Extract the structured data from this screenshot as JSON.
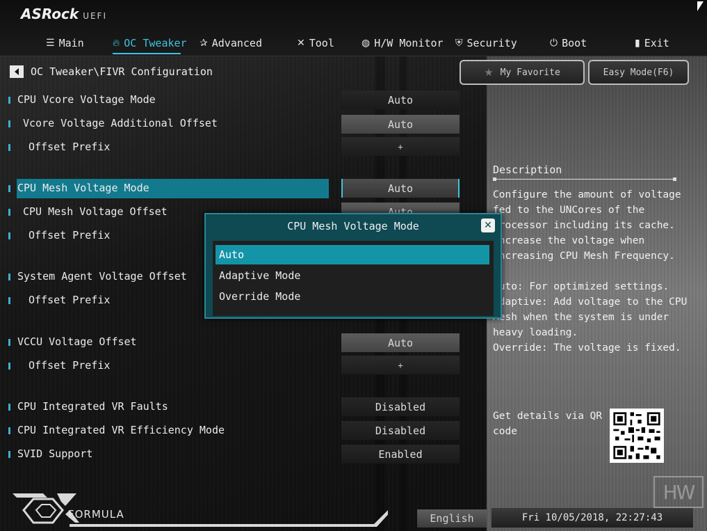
{
  "brand": {
    "name": "ASRock",
    "suffix": "UEFI"
  },
  "tabs": [
    {
      "label": "Main",
      "icon": "list-icon"
    },
    {
      "label": "OC Tweaker",
      "icon": "flame-icon",
      "active": true
    },
    {
      "label": "Advanced",
      "icon": "star-icon"
    },
    {
      "label": "Tool",
      "icon": "tools-icon"
    },
    {
      "label": "H/W Monitor",
      "icon": "monitor-icon"
    },
    {
      "label": "Security",
      "icon": "shield-icon"
    },
    {
      "label": "Boot",
      "icon": "power-icon"
    },
    {
      "label": "Exit",
      "icon": "exit-icon"
    }
  ],
  "breadcrumb": "OC Tweaker\\FIVR Configuration",
  "buttons": {
    "favorite": "My Favorite",
    "easy_mode": "Easy Mode(F6)"
  },
  "settings": [
    {
      "label": "CPU Vcore Voltage Mode",
      "value": "Auto"
    },
    {
      "label": "Vcore Voltage Additional Offset",
      "value": "Auto"
    },
    {
      "label": "Offset Prefix",
      "value": "+"
    },
    {
      "label": "CPU Mesh Voltage Mode",
      "value": "Auto",
      "selected": true
    },
    {
      "label": "CPU Mesh Voltage Offset",
      "value": "Auto"
    },
    {
      "label": "Offset Prefix",
      "value": ""
    },
    {
      "label": "System Agent Voltage Offset",
      "value": ""
    },
    {
      "label": "Offset Prefix",
      "value": ""
    },
    {
      "label": "VCCU Voltage Offset",
      "value": "Auto"
    },
    {
      "label": "Offset Prefix",
      "value": "+"
    },
    {
      "label": "CPU Integrated VR Faults",
      "value": "Disabled"
    },
    {
      "label": "CPU Integrated VR Efficiency Mode",
      "value": "Disabled"
    },
    {
      "label": "SVID Support",
      "value": "Enabled"
    }
  ],
  "description": {
    "title": "Description",
    "body": "Configure the amount of voltage\nfed to the UNCores of the\nprocessor including its cache.\nIncrease the voltage when\nincreasing CPU Mesh Frequency.\n\nAuto: For optimized settings.\nAdaptive: Add voltage to the CPU\nMesh when the system is under\nheavy loading.\nOverride: The voltage is fixed.",
    "qr_text": "Get details via QR code"
  },
  "modal": {
    "title": "CPU Mesh Voltage Mode",
    "options": [
      "Auto",
      "Adaptive Mode",
      "Override Mode"
    ],
    "selected_index": 0
  },
  "footer": {
    "logo_text": "FORMULA",
    "language": "English",
    "datetime": "Fri 10/05/2018, 22:27:43"
  },
  "watermark": "HW",
  "colors": {
    "accent": "#3fc4e0",
    "selected_row": "#137a8e",
    "modal_bg": "#0f4952",
    "selected_option": "#1494a7"
  }
}
